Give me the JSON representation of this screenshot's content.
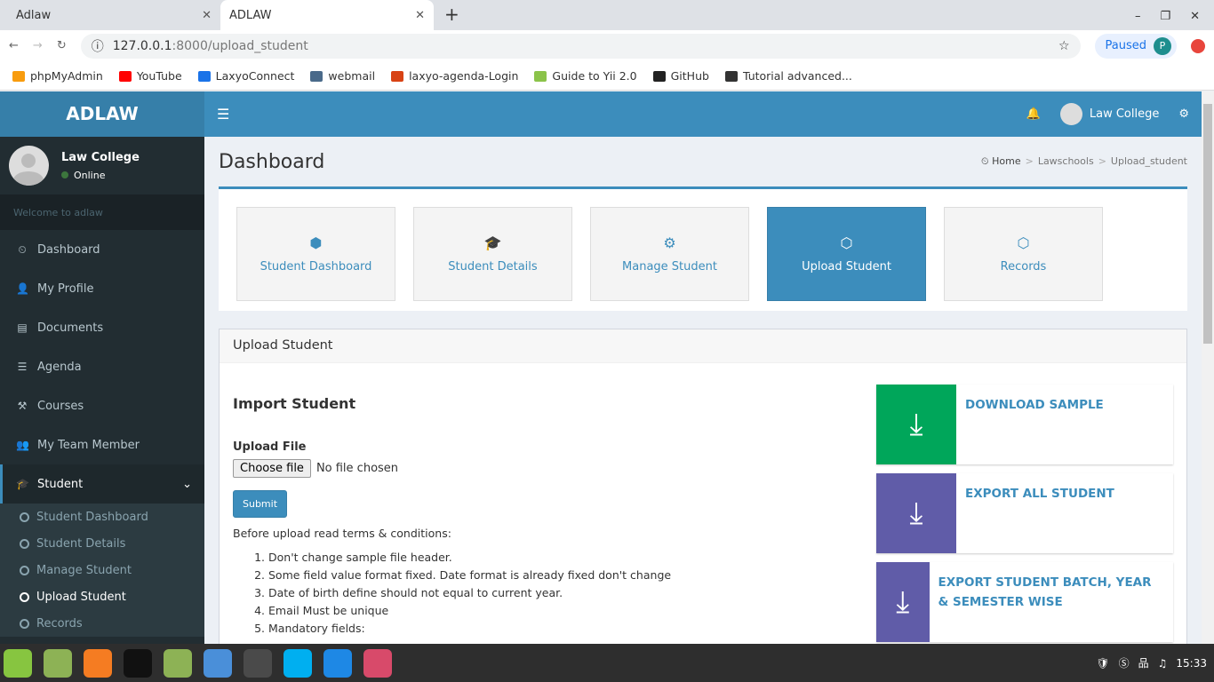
{
  "browser": {
    "tabs": [
      {
        "label": "Adlaw"
      },
      {
        "label": "ADLAW"
      }
    ],
    "url_host": "127.0.0.1",
    "url_rest": ":8000/upload_student",
    "paused": "Paused",
    "profile": "P",
    "bookmarks": [
      {
        "label": "phpMyAdmin",
        "color": "#f89c0e"
      },
      {
        "label": "YouTube",
        "color": "#ff0000"
      },
      {
        "label": "LaxyoConnect",
        "color": "#1a73e8"
      },
      {
        "label": "webmail",
        "color": "#4a6a8a"
      },
      {
        "label": "laxyo-agenda-Login",
        "color": "#d84315"
      },
      {
        "label": "Guide to Yii 2.0",
        "color": "#8bc34a"
      },
      {
        "label": "GitHub",
        "color": "#222"
      },
      {
        "label": "Tutorial advanced...",
        "color": "#333"
      }
    ]
  },
  "sidebar": {
    "logo": "ADLAW",
    "user": "Law College",
    "status": "Online",
    "welcome": "Welcome to adlaw",
    "items": [
      {
        "label": "Dashboard",
        "icon": "⏲"
      },
      {
        "label": "My Profile",
        "icon": "👤"
      },
      {
        "label": "Documents",
        "icon": "▤"
      },
      {
        "label": "Agenda",
        "icon": "☰"
      },
      {
        "label": "Courses",
        "icon": "⚒"
      },
      {
        "label": "My Team Member",
        "icon": "👥"
      },
      {
        "label": "Student",
        "icon": "🎓"
      }
    ],
    "sub": [
      "Student Dashboard",
      "Student Details",
      "Manage Student",
      "Upload Student",
      "Records"
    ]
  },
  "topbar": {
    "user": "Law College"
  },
  "page": {
    "title": "Dashboard",
    "crumbs": [
      "Home",
      "Lawschools",
      "Upload_student"
    ]
  },
  "cards": [
    {
      "label": "Student Dashboard",
      "icon": "⬢"
    },
    {
      "label": "Student Details",
      "icon": "🎓"
    },
    {
      "label": "Manage Student",
      "icon": "⚙"
    },
    {
      "label": "Upload Student",
      "icon": "⬡"
    },
    {
      "label": "Records",
      "icon": "⬡"
    }
  ],
  "upload": {
    "box_title": "Upload Student",
    "heading": "Import Student",
    "file_label": "Upload File",
    "choose": "Choose file",
    "no_file": "No file chosen",
    "submit": "Submit",
    "terms_intro": "Before upload read terms & conditions:",
    "terms": [
      "Don't change sample file header.",
      "Some field value format fixed. Date format is already fixed don't change",
      "Date of birth define should not equal to current year.",
      "Email Must be unique",
      "Mandatory fields:"
    ]
  },
  "actions": [
    {
      "label": "DOWNLOAD SAMPLE",
      "color": "#00a65a"
    },
    {
      "label": "EXPORT ALL STUDENT",
      "color": "#605ca8"
    },
    {
      "label": "EXPORT STUDENT BATCH, YEAR & SEMESTER WISE",
      "color": "#605ca8"
    }
  ],
  "taskbar": {
    "clock": "15:33",
    "apps": [
      {
        "name": "mint-menu",
        "color": "#87c540"
      },
      {
        "name": "files",
        "color": "#8db255"
      },
      {
        "name": "firefox",
        "color": "#f57c22"
      },
      {
        "name": "terminal",
        "color": "#111"
      },
      {
        "name": "folder",
        "color": "#8db255"
      },
      {
        "name": "chrome",
        "color": "#4a8fd9"
      },
      {
        "name": "sublime",
        "color": "#4a4a4a"
      },
      {
        "name": "skype",
        "color": "#00aff0"
      },
      {
        "name": "notes",
        "color": "#1e88e5"
      },
      {
        "name": "image-viewer",
        "color": "#d84a6a"
      }
    ]
  }
}
